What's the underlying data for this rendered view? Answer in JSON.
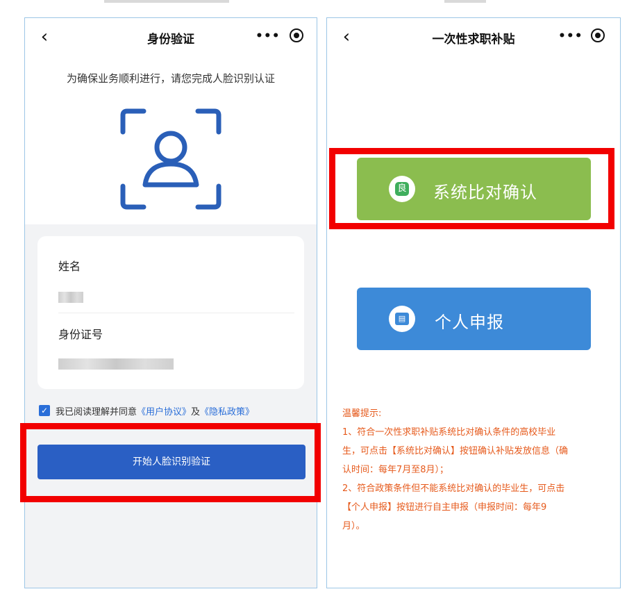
{
  "left": {
    "nav": {
      "back": "‹",
      "title": "身份验证",
      "more": "•••"
    },
    "instruction": "为确保业务顺利进行，请您完成人脸识别认证",
    "form": {
      "name_label": "姓名",
      "id_label": "身份证号"
    },
    "agreement": {
      "prefix": "我已阅读理解并同意",
      "link1": "《用户协议》",
      "mid": "及",
      "link2": "《隐私政策》"
    },
    "start_button": "开始人脸识别验证"
  },
  "right": {
    "nav": {
      "back": "‹",
      "title": "一次性求职补贴",
      "more": "•••"
    },
    "system_confirm_button": "系统比对确认",
    "personal_apply_button": "个人申报",
    "tips": {
      "title": "温馨提示:",
      "line1": "1、符合一次性求职补贴系统比对确认条件的高校毕业",
      "line2": "生，可点击【系统比对确认】按钮确认补贴发放信息（确",
      "line3": "认时间：每年7月至8月）；",
      "line4": "2、符合政策条件但不能系统比对确认的毕业生，可点击",
      "line5": "【个人申报】按钮进行自主申报（申报时间：每年9",
      "line6": "月）。"
    }
  },
  "colors": {
    "highlight_red": "#f20000",
    "primary_blue": "#2a5fc4",
    "system_green": "#8bbd4f",
    "apply_blue": "#3d8ad8",
    "tip_orange": "#e65a1c",
    "face_icon_blue": "#2a5fb8"
  },
  "icons": [
    "back-chevron-icon",
    "more-options-icon",
    "target-icon",
    "face-scan-icon",
    "checkbox-checked-icon",
    "id-card-icon"
  ]
}
